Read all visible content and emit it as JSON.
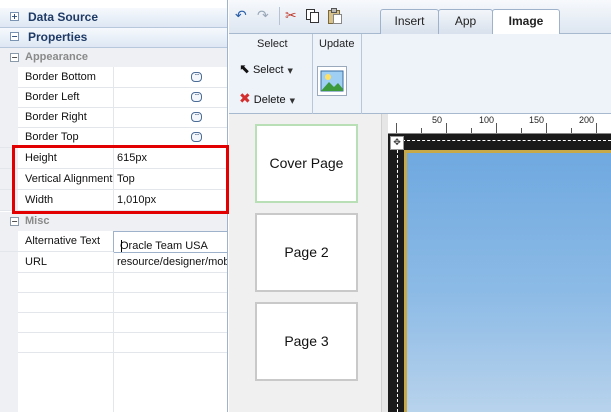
{
  "properties_panel": {
    "sections": [
      {
        "label": "Data Source",
        "toggle": "+"
      },
      {
        "label": "Properties",
        "toggle": "−"
      }
    ],
    "appearance_group": {
      "label": "Appearance",
      "toggle": "−",
      "rows": [
        {
          "name": "Border Bottom",
          "value": "",
          "edit_icon": "edit-dots-icon"
        },
        {
          "name": "Border Left",
          "value": "",
          "edit_icon": "edit-dots-icon"
        },
        {
          "name": "Border Right",
          "value": "",
          "edit_icon": "edit-dots-icon"
        },
        {
          "name": "Border Top",
          "value": "",
          "edit_icon": "edit-dots-icon"
        },
        {
          "name": "Height",
          "value": "615px"
        },
        {
          "name": "Vertical Alignment",
          "value": "Top"
        },
        {
          "name": "Width",
          "value": "1,010px"
        }
      ]
    },
    "misc_group": {
      "label": "Misc",
      "toggle": "−",
      "rows": [
        {
          "name": "Alternative Text",
          "value": "Oracle Team USA"
        },
        {
          "name": "URL",
          "value": "resource/designer/mob"
        }
      ]
    },
    "highlight_color": "#e30000"
  },
  "toolbar": {
    "icons": [
      "undo-icon",
      "redo-icon",
      "cut-icon",
      "copy-icon",
      "paste-icon"
    ],
    "tabs": [
      {
        "label": "Insert",
        "active": false
      },
      {
        "label": "App",
        "active": false
      },
      {
        "label": "Image",
        "active": true
      }
    ]
  },
  "ribbon": {
    "select_group": {
      "title": "Select",
      "select_label": "Select",
      "delete_label": "Delete"
    },
    "update_group": {
      "title": "Update",
      "image_icon": "image-icon"
    }
  },
  "pages": [
    {
      "label": "Cover Page",
      "selected": true
    },
    {
      "label": "Page 2",
      "selected": false
    },
    {
      "label": "Page 3",
      "selected": false
    }
  ],
  "ruler": {
    "labels": [
      "50",
      "100",
      "150",
      "200"
    ]
  },
  "colors": {
    "selected_page_border": "#b8dfb6",
    "image_frame": "#c8a94a",
    "image_fill": "#7bb0e2",
    "panel_header": "#1e3a66"
  }
}
